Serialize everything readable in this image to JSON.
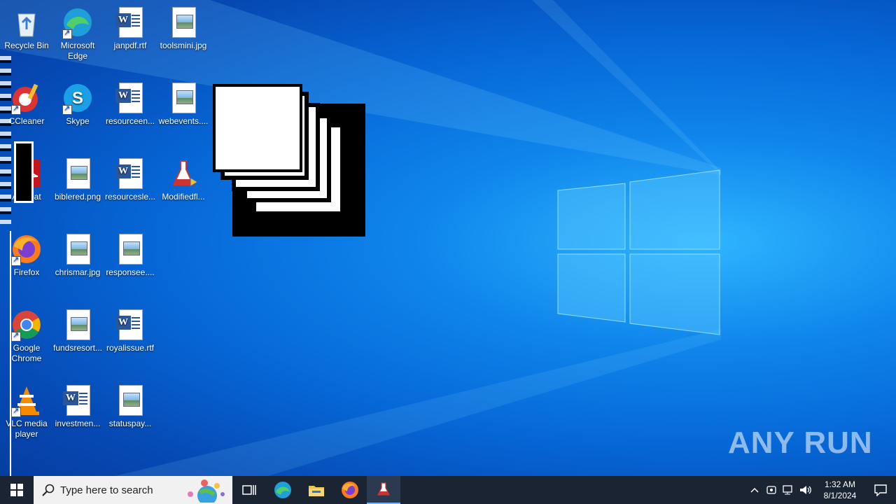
{
  "desktop": {
    "icons": [
      {
        "label": "Recycle Bin"
      },
      {
        "label": "Microsoft Edge"
      },
      {
        "label": "janpdf.rtf"
      },
      {
        "label": "toolsmini.jpg"
      },
      {
        "label": "CCleaner"
      },
      {
        "label": "Skype"
      },
      {
        "label": "resourceen..."
      },
      {
        "label": "webevents...."
      },
      {
        "label": "Acrobat"
      },
      {
        "label": "biblered.png"
      },
      {
        "label": "resourcesle..."
      },
      {
        "label": "Modifiedfl..."
      },
      {
        "label": "Firefox"
      },
      {
        "label": "chrismar.jpg"
      },
      {
        "label": "responsee...."
      },
      {
        "label": "Google Chrome"
      },
      {
        "label": "fundsresort..."
      },
      {
        "label": "royalissue.rtf"
      },
      {
        "label": "VLC media player"
      },
      {
        "label": "investmen..."
      },
      {
        "label": "statuspay..."
      }
    ]
  },
  "taskbar": {
    "search_placeholder": "Type here to search",
    "clock_time": "1:32 AM",
    "clock_date": "8/1/2024"
  },
  "watermark": "ANY RUN"
}
